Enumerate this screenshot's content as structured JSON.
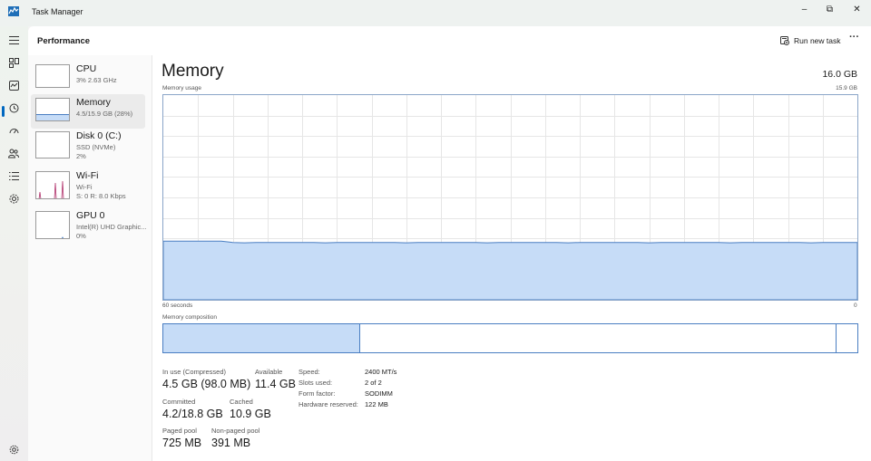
{
  "window": {
    "title": "Task Manager",
    "minimize_glyph": "–",
    "maximize_glyph": "⧉",
    "close_glyph": "✕"
  },
  "header": {
    "title": "Performance",
    "run_new_task": "Run new task",
    "more_glyph": "···"
  },
  "nav": {
    "items": [
      "menu-icon",
      "processes-icon",
      "performance-icon",
      "app-history-icon",
      "startup-apps-icon",
      "users-icon",
      "details-icon",
      "services-icon",
      "settings-icon"
    ],
    "active": "performance-icon"
  },
  "devices": [
    {
      "name": "CPU",
      "sub1": "3% 2.63 GHz",
      "sub2": "",
      "sub3": ""
    },
    {
      "name": "Memory",
      "sub1": "4.5/15.9 GB (28%)",
      "sub2": "",
      "sub3": ""
    },
    {
      "name": "Disk 0 (C:)",
      "sub1": "SSD (NVMe)",
      "sub2": "2%",
      "sub3": ""
    },
    {
      "name": "Wi-Fi",
      "sub1": "Wi-Fi",
      "sub2": "S: 0 R: 8.0 Kbps",
      "sub3": ""
    },
    {
      "name": "GPU 0",
      "sub1": "Intel(R) UHD Graphic...",
      "sub2": "0%",
      "sub3": ""
    }
  ],
  "main": {
    "title": "Memory",
    "total": "16.0 GB",
    "usage_label": "Memory usage",
    "usage_max": "15.9 GB",
    "axis_left": "60 seconds",
    "axis_right": "0",
    "composition_label": "Memory composition",
    "usage_fraction": 0.28
  },
  "stats": {
    "in_use_label": "In use (Compressed)",
    "in_use_value": "4.5 GB (98.0 MB)",
    "available_label": "Available",
    "available_value": "11.4 GB",
    "committed_label": "Committed",
    "committed_value": "4.2/18.8 GB",
    "cached_label": "Cached",
    "cached_value": "10.9 GB",
    "paged_label": "Paged pool",
    "paged_value": "725 MB",
    "nonpaged_label": "Non-paged pool",
    "nonpaged_value": "391 MB"
  },
  "specs": [
    {
      "label": "Speed:",
      "value": "2400 MT/s"
    },
    {
      "label": "Slots used:",
      "value": "2 of 2"
    },
    {
      "label": "Form factor:",
      "value": "SODIMM"
    },
    {
      "label": "Hardware reserved:",
      "value": "122 MB"
    }
  ],
  "colors": {
    "accent": "#0067c0",
    "memory_fill": "#c6dcf7",
    "memory_line": "#4a7ec2",
    "wifi_line": "#b0306a"
  }
}
